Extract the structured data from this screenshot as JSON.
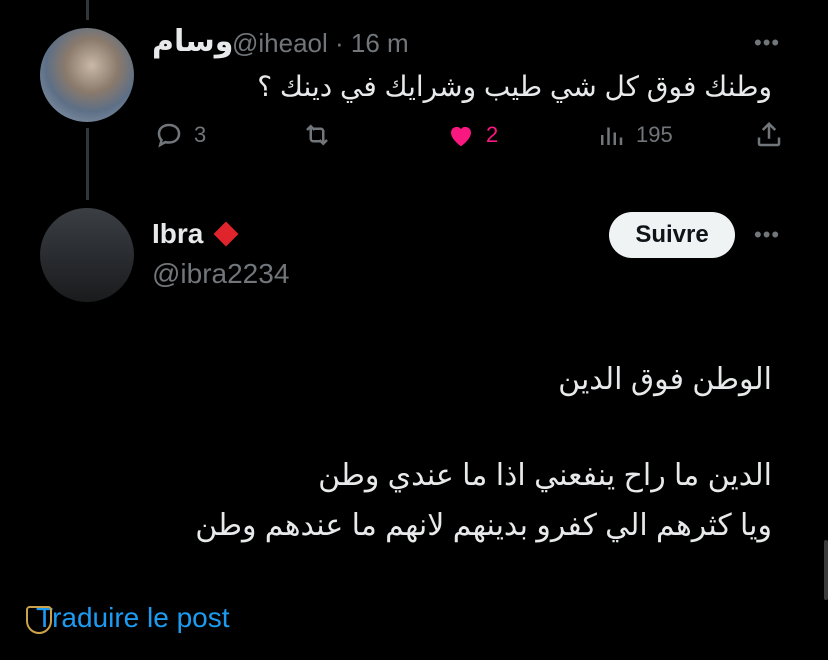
{
  "tweet1": {
    "name": "وسام",
    "handle": "@iheaol",
    "time": "· 16 m",
    "text": "وطنك فوق كل شي طيب وشرايك في دينك ؟",
    "more": "•••",
    "actions": {
      "replies": "3",
      "retweets": "",
      "likes": "2",
      "views": "195"
    }
  },
  "tweet2": {
    "name": "Ibra",
    "handle": "@ibra2234",
    "follow_label": "Suivre",
    "more": "•••",
    "lines": [
      "الوطن فوق الدين",
      "الدين ما راح ينفعني اذا ما عندي وطن",
      "ويا كثرهم الي كفرو بدينهم لانهم ما عندهم وطن"
    ],
    "translate_label": "Traduire le post"
  },
  "colors": {
    "background": "#000000",
    "text": "#e7e9ea",
    "secondary": "#71767b",
    "like": "#f91880",
    "link": "#1d9bf0"
  }
}
